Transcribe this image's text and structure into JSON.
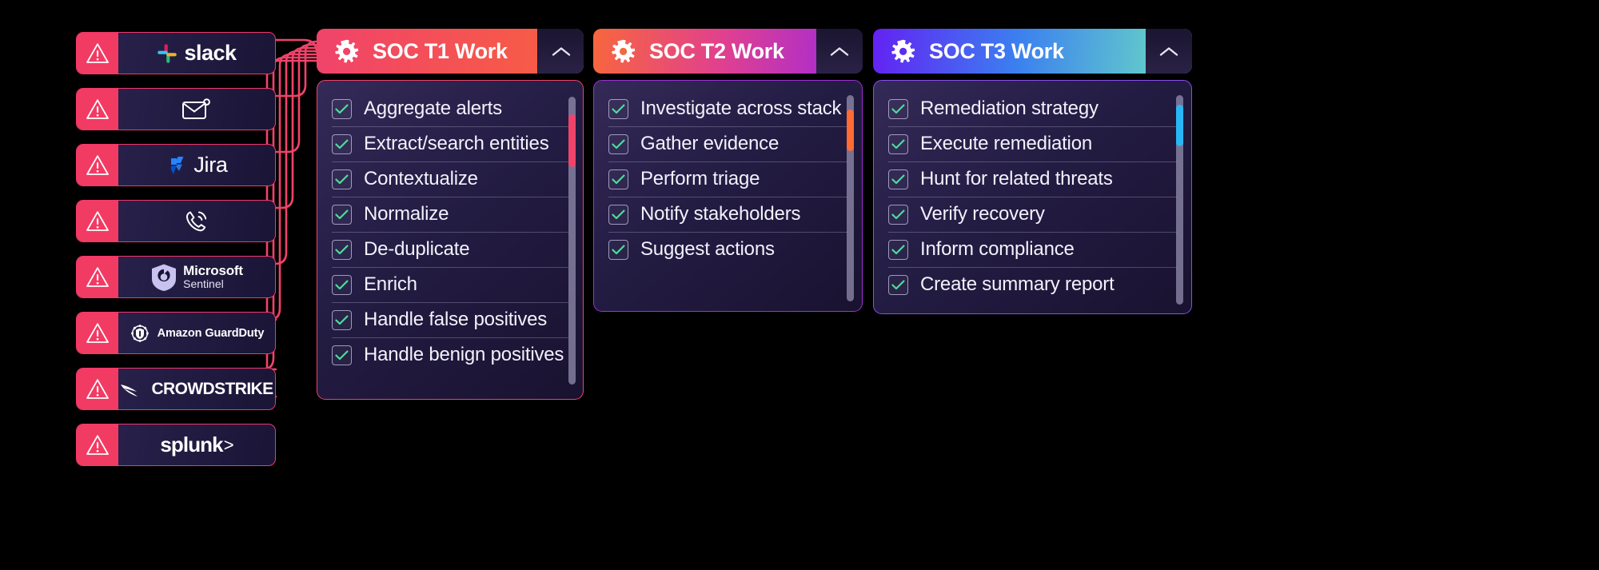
{
  "canvas": {
    "background": "#000000"
  },
  "sources": {
    "alert_icon": "warning-triangle-icon",
    "items": [
      {
        "id": "slack",
        "name": "Slack",
        "logo": "slack-logo",
        "label": "slack"
      },
      {
        "id": "email",
        "name": "Email",
        "logo": "envelope-icon",
        "label": ""
      },
      {
        "id": "jira",
        "name": "Jira",
        "logo": "jira-logo",
        "label": "Jira"
      },
      {
        "id": "phone",
        "name": "Phone",
        "logo": "phone-ring-icon",
        "label": ""
      },
      {
        "id": "sentinel",
        "name": "Microsoft Sentinel",
        "logo": "microsoft-sentinel-logo",
        "label": "Microsoft",
        "sublabel": "Sentinel"
      },
      {
        "id": "guardduty",
        "name": "Amazon GuardDuty",
        "logo": "amazon-guardduty-logo",
        "label": "Amazon GuardDuty"
      },
      {
        "id": "crowdstrike",
        "name": "CrowdStrike",
        "logo": "crowdstrike-logo",
        "label": "CROWDSTRIKE"
      },
      {
        "id": "splunk",
        "name": "Splunk",
        "logo": "splunk-logo",
        "label": "splunk",
        "suffix": ">"
      }
    ]
  },
  "panels": [
    {
      "id": "t1",
      "title": "SOC T1 Work",
      "icon": "gear-icon",
      "toggle_icon": "chevron-up-icon",
      "accent": "#f0436a",
      "header_gradient_from": "#f0436a",
      "header_gradient_to": "#f8603f",
      "scrollbar": {
        "thumb_color": "#f0436a",
        "thumb_position_pct": 6,
        "thumb_size_pct": 18
      },
      "tasks": [
        {
          "label": "Aggregate alerts",
          "checked": true
        },
        {
          "label": "Extract/search entities",
          "checked": true
        },
        {
          "label": "Contextualize",
          "checked": true
        },
        {
          "label": "Normalize",
          "checked": true
        },
        {
          "label": "De-duplicate",
          "checked": true
        },
        {
          "label": "Enrich",
          "checked": true
        },
        {
          "label": "Handle false positives",
          "checked": true
        },
        {
          "label": "Handle benign positives",
          "checked": true
        }
      ]
    },
    {
      "id": "t2",
      "title": "SOC T2 Work",
      "icon": "gear-icon",
      "toggle_icon": "chevron-up-icon",
      "accent": "#9c27e0",
      "header_gradient_from": "#f8663d",
      "header_gradient_to": "#9c27e0",
      "scrollbar": {
        "thumb_color": "#ff6b35",
        "thumb_position_pct": 6,
        "thumb_size_pct": 20
      },
      "tasks": [
        {
          "label": "Investigate across stack",
          "checked": true
        },
        {
          "label": "Gather evidence",
          "checked": true
        },
        {
          "label": "Perform triage",
          "checked": true
        },
        {
          "label": "Notify stakeholders",
          "checked": true
        },
        {
          "label": "Suggest actions",
          "checked": true
        }
      ]
    },
    {
      "id": "t3",
      "title": "SOC T3 Work",
      "icon": "gear-icon",
      "toggle_icon": "chevron-up-icon",
      "accent": "#6de0c0",
      "header_gradient_from": "#6322f3",
      "header_gradient_to": "#6de0c0",
      "scrollbar": {
        "thumb_color": "#29b6f6",
        "thumb_position_pct": 4,
        "thumb_size_pct": 19
      },
      "tasks": [
        {
          "label": "Remediation strategy",
          "checked": true
        },
        {
          "label": "Execute remediation",
          "checked": true
        },
        {
          "label": "Hunt for related threats",
          "checked": true
        },
        {
          "label": "Verify recovery",
          "checked": true
        },
        {
          "label": "Inform compliance",
          "checked": true
        },
        {
          "label": "Create summary report",
          "checked": true
        }
      ]
    }
  ],
  "connectors": {
    "color": "#f0436a",
    "count": 8,
    "from": "sources",
    "to": "panel-t1"
  }
}
